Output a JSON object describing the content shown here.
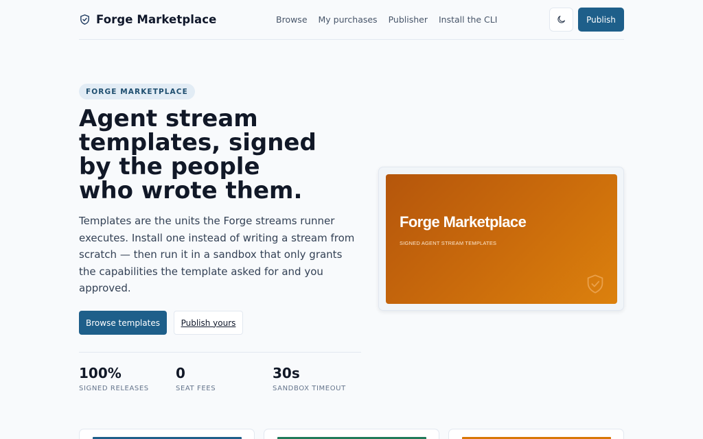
{
  "header": {
    "brand": "Forge Marketplace",
    "brand_icon": "shield-check-icon",
    "nav": [
      "Browse",
      "My purchases",
      "Publisher",
      "Install the CLI"
    ],
    "theme_icon": "moon-icon",
    "publish_label": "Publish"
  },
  "hero": {
    "eyebrow": "FORGE MARKETPLACE",
    "title_lines": [
      "Agent stream",
      "templates, signed",
      "by the people",
      "who wrote them."
    ],
    "description": "Templates are the units the Forge streams runner executes. Install one instead of writing a stream from scratch — then run it in a sandbox that only grants the capabilities the template asked for and you approved.",
    "primary_cta": "Browse templates",
    "secondary_cta": "Publish yours"
  },
  "stats": [
    {
      "value": "100%",
      "label": "SIGNED RELEASES"
    },
    {
      "value": "0",
      "label": "SEAT FEES"
    },
    {
      "value": "30s",
      "label": "SANDBOX TIMEOUT"
    }
  ],
  "preview": {
    "title": "Forge Marketplace",
    "subtitle": "SIGNED AGENT STREAM TEMPLATES",
    "icon": "shield-check-icon"
  },
  "cards": [
    {
      "accent": "#1e5f8a"
    },
    {
      "accent": "#1f7a5a"
    },
    {
      "accent": "#d97706"
    }
  ],
  "colors": {
    "primary": "#1e5f8a",
    "background": "#f8fafc",
    "preview_gradient_start": "#b5560c",
    "preview_gradient_end": "#dc810d"
  }
}
